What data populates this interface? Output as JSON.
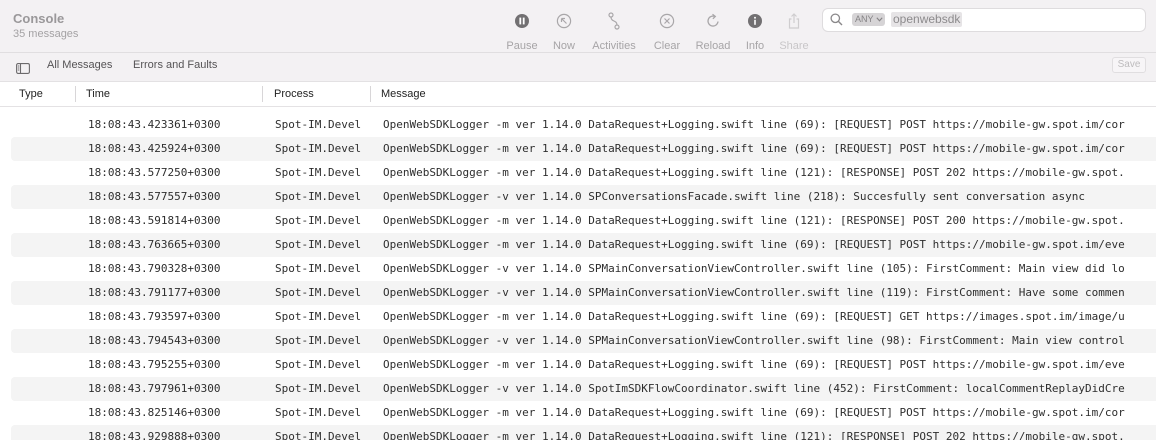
{
  "app": {
    "title": "Console",
    "message_count": "35 messages"
  },
  "toolbar": {
    "pause": {
      "label": "Pause",
      "icon": "pause-icon"
    },
    "now": {
      "label": "Now",
      "icon": "now-arrow-icon"
    },
    "activities": {
      "label": "Activities",
      "icon": "activities-icon"
    },
    "clear": {
      "label": "Clear",
      "icon": "clear-icon"
    },
    "reload": {
      "label": "Reload",
      "icon": "reload-icon"
    },
    "info": {
      "label": "Info",
      "icon": "info-icon"
    },
    "share": {
      "label": "Share",
      "icon": "share-icon"
    }
  },
  "search": {
    "scope": "ANY",
    "term": "openwebsdk"
  },
  "filters": {
    "all_messages": "All Messages",
    "errors_faults": "Errors and Faults",
    "save": "Save"
  },
  "table": {
    "columns": {
      "type": "Type",
      "time": "Time",
      "process": "Process",
      "message": "Message"
    },
    "rows": [
      {
        "time": "18:08:43.423361+0300",
        "process": "Spot-IM.Devel",
        "message": "OpenWebSDKLogger -m ver 1.14.0 DataRequest+Logging.swift line (69): [REQUEST] POST https://mobile-gw.spot.im/cor"
      },
      {
        "time": "18:08:43.425924+0300",
        "process": "Spot-IM.Devel",
        "message": "OpenWebSDKLogger -m ver 1.14.0 DataRequest+Logging.swift line (69): [REQUEST] POST https://mobile-gw.spot.im/cor"
      },
      {
        "time": "18:08:43.577250+0300",
        "process": "Spot-IM.Devel",
        "message": "OpenWebSDKLogger -m ver 1.14.0 DataRequest+Logging.swift line (121): [RESPONSE] POST 202 https://mobile-gw.spot."
      },
      {
        "time": "18:08:43.577557+0300",
        "process": "Spot-IM.Devel",
        "message": "OpenWebSDKLogger -v ver 1.14.0 SPConversationsFacade.swift line (218): Succesfully sent conversation async"
      },
      {
        "time": "18:08:43.591814+0300",
        "process": "Spot-IM.Devel",
        "message": "OpenWebSDKLogger -m ver 1.14.0 DataRequest+Logging.swift line (121): [RESPONSE] POST 200 https://mobile-gw.spot."
      },
      {
        "time": "18:08:43.763665+0300",
        "process": "Spot-IM.Devel",
        "message": "OpenWebSDKLogger -m ver 1.14.0 DataRequest+Logging.swift line (69): [REQUEST] POST https://mobile-gw.spot.im/eve"
      },
      {
        "time": "18:08:43.790328+0300",
        "process": "Spot-IM.Devel",
        "message": "OpenWebSDKLogger -v ver 1.14.0 SPMainConversationViewController.swift line (105): FirstComment: Main view did lo"
      },
      {
        "time": "18:08:43.791177+0300",
        "process": "Spot-IM.Devel",
        "message": "OpenWebSDKLogger -v ver 1.14.0 SPMainConversationViewController.swift line (119): FirstComment: Have some commen"
      },
      {
        "time": "18:08:43.793597+0300",
        "process": "Spot-IM.Devel",
        "message": "OpenWebSDKLogger -m ver 1.14.0 DataRequest+Logging.swift line (69): [REQUEST] GET https://images.spot.im/image/u"
      },
      {
        "time": "18:08:43.794543+0300",
        "process": "Spot-IM.Devel",
        "message": "OpenWebSDKLogger -v ver 1.14.0 SPMainConversationViewController.swift line (98): FirstComment: Main view control"
      },
      {
        "time": "18:08:43.795255+0300",
        "process": "Spot-IM.Devel",
        "message": "OpenWebSDKLogger -m ver 1.14.0 DataRequest+Logging.swift line (69): [REQUEST] POST https://mobile-gw.spot.im/eve"
      },
      {
        "time": "18:08:43.797961+0300",
        "process": "Spot-IM.Devel",
        "message": "OpenWebSDKLogger -v ver 1.14.0 SpotImSDKFlowCoordinator.swift line (452): FirstComment: localCommentReplayDidCre"
      },
      {
        "time": "18:08:43.825146+0300",
        "process": "Spot-IM.Devel",
        "message": "OpenWebSDKLogger -m ver 1.14.0 DataRequest+Logging.swift line (69): [REQUEST] POST https://mobile-gw.spot.im/cor"
      },
      {
        "time": "18:08:43.929888+0300",
        "process": "Spot-IM.Devel",
        "message": "OpenWebSDKLogger -m ver 1.14.0 DataRequest+Logging.swift line (121): [RESPONSE] POST 202 https://mobile-gw.spot."
      }
    ]
  },
  "colors": {
    "toolbar_bg": "#f3f1f3",
    "row_alt_bg": "#f4f4f4",
    "icon_dark": "#727072",
    "icon_muted": "#a9a7a9"
  }
}
